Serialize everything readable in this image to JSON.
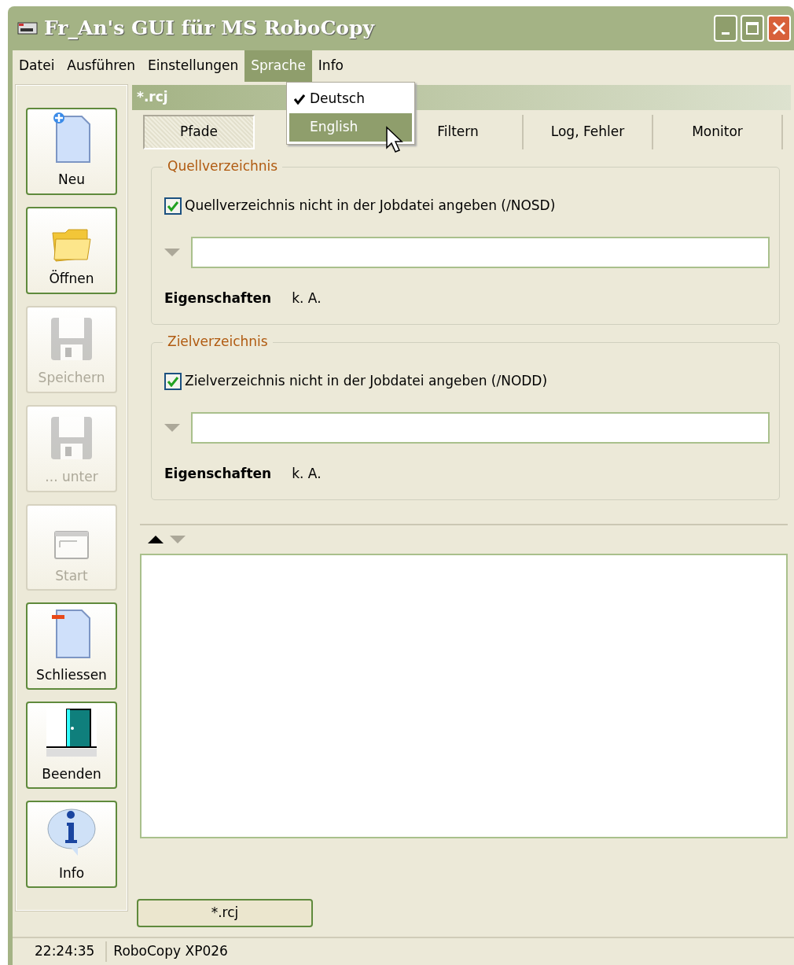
{
  "window": {
    "title": "Fr_An's GUI für MS RoboCopy"
  },
  "menu": [
    {
      "label": "Datei",
      "selected": false
    },
    {
      "label": "Ausführen",
      "selected": false
    },
    {
      "label": "Einstellungen",
      "selected": false
    },
    {
      "label": "Sprache",
      "selected": true
    },
    {
      "label": "Info",
      "selected": false
    }
  ],
  "dropdown": [
    {
      "label": "Deutsch",
      "checked": true,
      "selected": false
    },
    {
      "label": "English",
      "checked": false,
      "selected": true
    }
  ],
  "toolbar": [
    {
      "label": "Neu",
      "kind": "new",
      "disabled": false
    },
    {
      "label": "Öffnen",
      "kind": "open",
      "disabled": false
    },
    {
      "label": "Speichern",
      "kind": "save",
      "disabled": true
    },
    {
      "label": "... unter",
      "kind": "save",
      "disabled": true
    },
    {
      "label": "Start",
      "kind": "start",
      "disabled": true
    },
    {
      "label": "Schliessen",
      "kind": "close",
      "disabled": false
    },
    {
      "label": "Beenden",
      "kind": "exit",
      "disabled": false
    },
    {
      "label": "Info",
      "kind": "info",
      "disabled": false
    }
  ],
  "document": {
    "title": "*.rcj"
  },
  "tabs": [
    {
      "label": "Pfade",
      "selected": true
    },
    {
      "label": "Filtern",
      "selected": false
    },
    {
      "label": "Log, Fehler",
      "selected": false
    },
    {
      "label": "Monitor",
      "selected": false
    }
  ],
  "groups": [
    {
      "title": "Quellverzeichnis",
      "checkbox": {
        "label": "Quellverzeichnis nicht in der Jobdatei angeben (/NOSD)",
        "checked": true
      },
      "property_label": "Eigenschaften",
      "property_value": "k. A."
    },
    {
      "title": "Zielverzeichnis",
      "checkbox": {
        "label": "Zielverzeichnis nicht in der Jobdatei angeben (/NODD)",
        "checked": true
      },
      "property_label": "Eigenschaften",
      "property_value": "k. A."
    }
  ],
  "document_tabs": [
    {
      "label": "*.rcj"
    }
  ],
  "status_bar": [
    "22:24:35",
    "RoboCopy XP026"
  ]
}
